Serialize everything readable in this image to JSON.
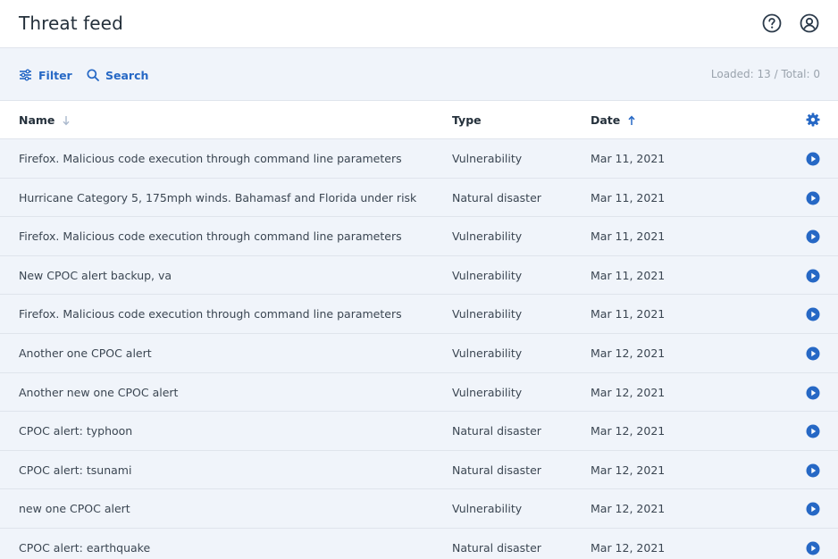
{
  "header": {
    "title": "Threat feed"
  },
  "toolbar": {
    "filter_label": "Filter",
    "search_label": "Search",
    "loaded_text": "Loaded: 13 / Total: 0"
  },
  "table": {
    "columns": {
      "name": "Name",
      "type": "Type",
      "date": "Date"
    },
    "rows": [
      {
        "name": "Firefox. Malicious code execution through command line parameters",
        "type": "Vulnerability",
        "date": "Mar 11, 2021"
      },
      {
        "name": "Hurricane Category 5, 175mph winds. Bahamasf and Florida under risk",
        "type": "Natural disaster",
        "date": "Mar 11, 2021"
      },
      {
        "name": "Firefox. Malicious code execution through command line parameters",
        "type": "Vulnerability",
        "date": "Mar 11, 2021"
      },
      {
        "name": "New CPOC alert backup, va",
        "type": "Vulnerability",
        "date": "Mar 11, 2021"
      },
      {
        "name": "Firefox. Malicious code execution through command line parameters",
        "type": "Vulnerability",
        "date": "Mar 11, 2021"
      },
      {
        "name": "Another one CPOC alert",
        "type": "Vulnerability",
        "date": "Mar 12, 2021"
      },
      {
        "name": "Another new one CPOC alert",
        "type": "Vulnerability",
        "date": "Mar 12, 2021"
      },
      {
        "name": "CPOC alert: typhoon",
        "type": "Natural disaster",
        "date": "Mar 12, 2021"
      },
      {
        "name": "CPOC alert: tsunami",
        "type": "Natural disaster",
        "date": "Mar 12, 2021"
      },
      {
        "name": "new one CPOC alert",
        "type": "Vulnerability",
        "date": "Mar 12, 2021"
      },
      {
        "name": "CPOC alert: earthquake",
        "type": "Natural disaster",
        "date": "Mar 12, 2021"
      }
    ]
  },
  "icons": {
    "help": "question-circle-icon",
    "profile": "user-circle-icon",
    "filter": "sliders-icon",
    "search": "search-icon",
    "settings": "gear-icon",
    "row_action": "play-circle-icon",
    "sort_name": "arrow-down-icon",
    "sort_date": "arrow-up-icon"
  },
  "colors": {
    "accent": "#2668c5",
    "row_background": "#f0f4fa",
    "border": "#dfe4ec",
    "muted_text": "#9aa3ad"
  }
}
